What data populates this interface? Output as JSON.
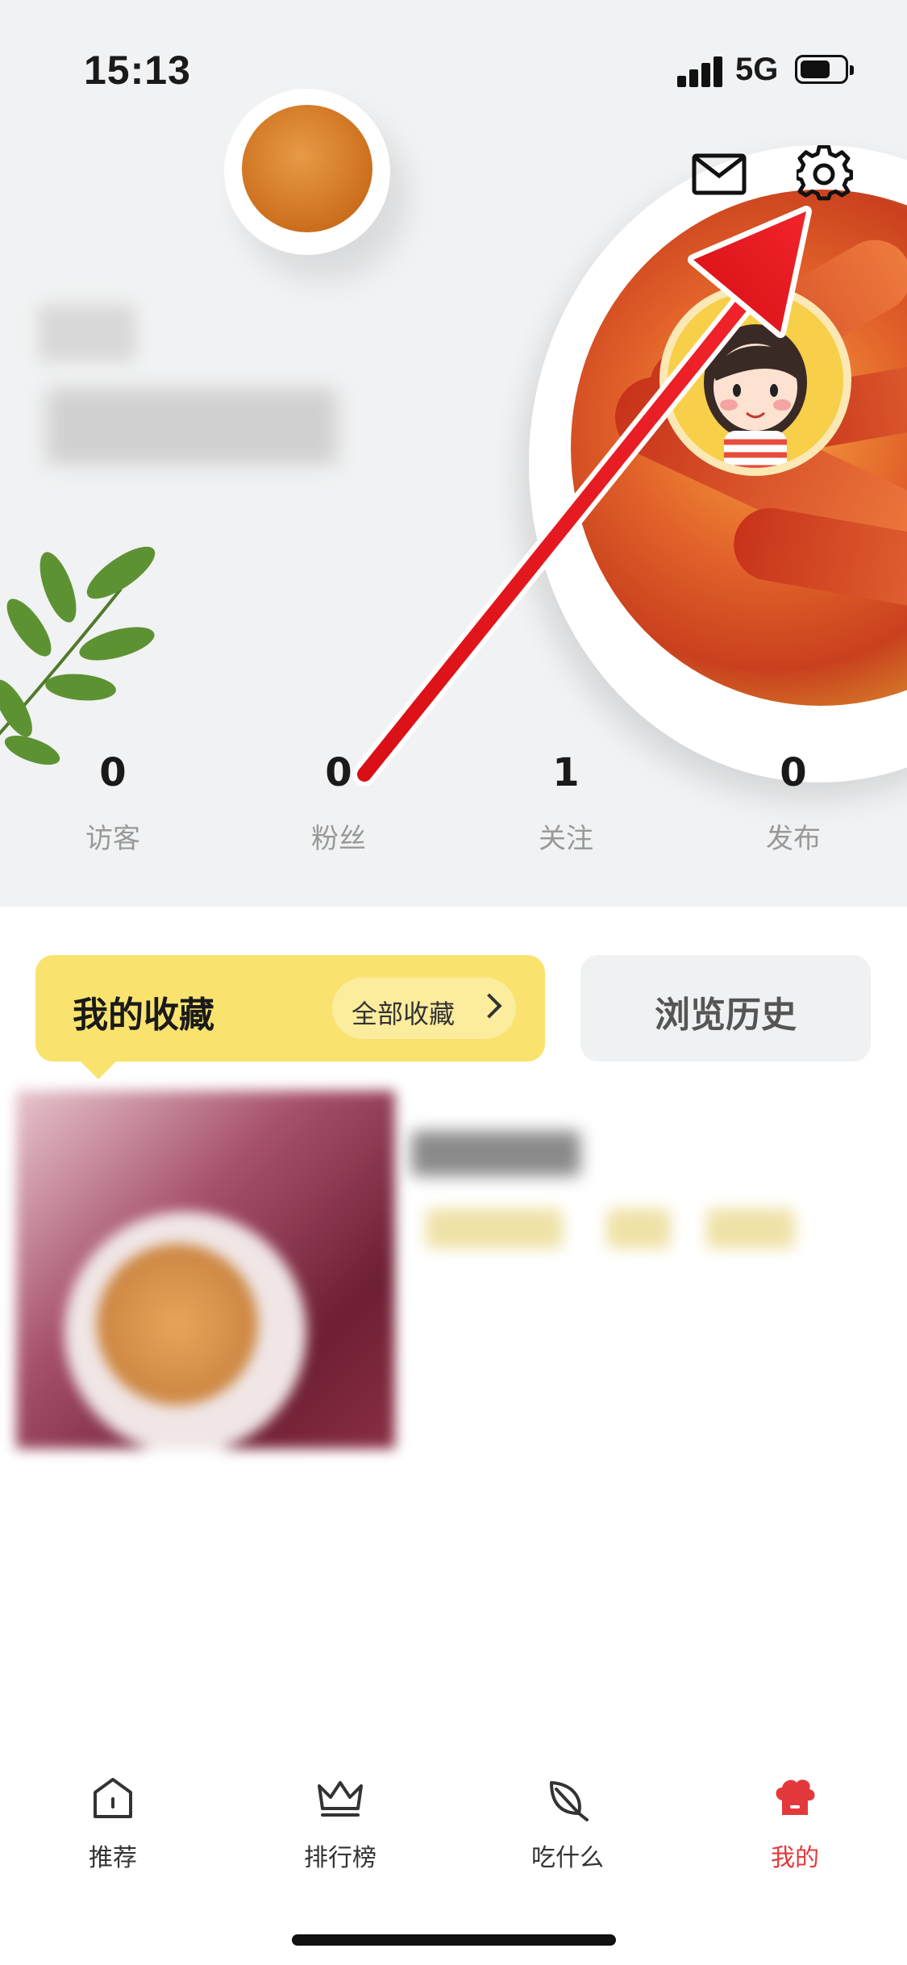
{
  "status_bar": {
    "time": "15:13",
    "network": "5G"
  },
  "header": {
    "icons": [
      "mail-icon",
      "gear-icon"
    ],
    "stats": [
      {
        "value": "0",
        "label": "访客"
      },
      {
        "value": "0",
        "label": "粉丝"
      },
      {
        "value": "1",
        "label": "关注"
      },
      {
        "value": "0",
        "label": "发布"
      }
    ]
  },
  "collections": {
    "title": "我的收藏",
    "all_label": "全部收藏",
    "history_label": "浏览历史"
  },
  "tab_bar": {
    "tabs": [
      {
        "label": "推荐",
        "icon": "home-icon"
      },
      {
        "label": "排行榜",
        "icon": "crown-icon"
      },
      {
        "label": "吃什么",
        "icon": "leaf-icon"
      },
      {
        "label": "我的",
        "icon": "chef-hat-icon",
        "active": true
      }
    ]
  },
  "colors": {
    "accent": "#e4393c",
    "favorites_card": "#f9e36e",
    "annotation_arrow": "#e8141b"
  }
}
